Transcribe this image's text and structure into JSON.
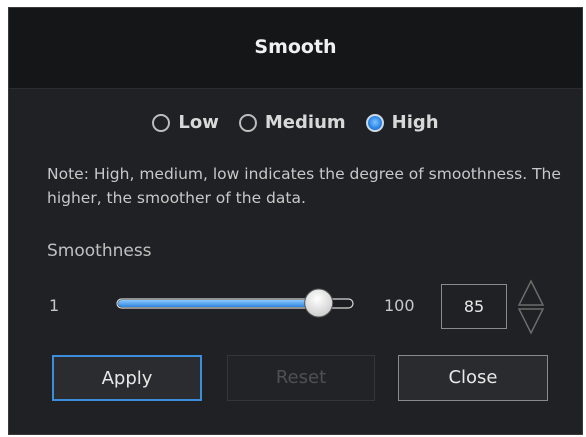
{
  "dialog": {
    "title": "Smooth"
  },
  "levels": [
    {
      "label": "Low",
      "checked": false
    },
    {
      "label": "Medium",
      "checked": false
    },
    {
      "label": "High",
      "checked": true
    }
  ],
  "note": "Note: High, medium, low indicates the degree of smoothness. The higher, the smoother of the data.",
  "smoothness": {
    "label": "Smoothness",
    "min_label": "1",
    "max_label": "100",
    "value": "85",
    "min": 1,
    "max": 100
  },
  "buttons": {
    "apply": "Apply",
    "reset": "Reset",
    "close": "Close"
  },
  "colors": {
    "accent": "#2d88e8",
    "slider_fill": "#4aa3f5"
  }
}
